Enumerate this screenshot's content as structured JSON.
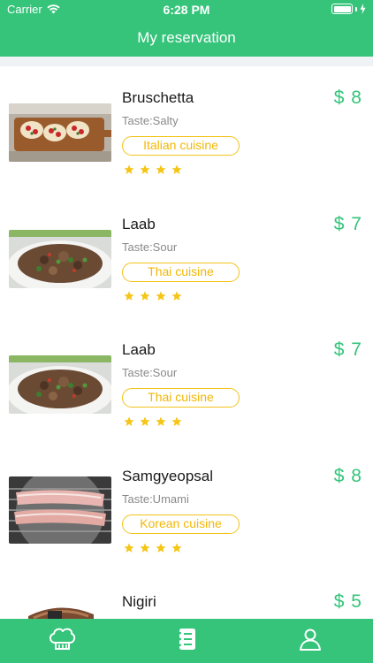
{
  "status_bar": {
    "carrier": "Carrier",
    "time": "6:28 PM"
  },
  "nav": {
    "title": "My reservation"
  },
  "colors": {
    "brand_green": "#35c47a",
    "tag_yellow": "#f2c318",
    "star_gold": "#f5c518",
    "price_green": "#35c47a"
  },
  "reservations": [
    {
      "name": "Bruschetta",
      "taste": "Taste:Salty",
      "cuisine": "Italian cuisine",
      "price": "$ 8",
      "rating": 4,
      "image": "bruschetta-photo"
    },
    {
      "name": "Laab",
      "taste": "Taste:Sour",
      "cuisine": "Thai cuisine",
      "price": "$ 7",
      "rating": 4,
      "image": "laab-photo"
    },
    {
      "name": "Laab",
      "taste": "Taste:Sour",
      "cuisine": "Thai cuisine",
      "price": "$ 7",
      "rating": 4,
      "image": "laab-photo"
    },
    {
      "name": "Samgyeopsal",
      "taste": "Taste:Umami",
      "cuisine": "Korean cuisine",
      "price": "$ 8",
      "rating": 4,
      "image": "samgyeopsal-photo"
    },
    {
      "name": "Nigiri",
      "taste": "",
      "cuisine": "",
      "price": "$ 5",
      "rating": 0,
      "image": "nigiri-photo"
    }
  ],
  "tab_bar": {
    "tabs": [
      {
        "icon": "chef-hat-icon"
      },
      {
        "icon": "menu-book-icon"
      },
      {
        "icon": "user-icon"
      }
    ]
  }
}
